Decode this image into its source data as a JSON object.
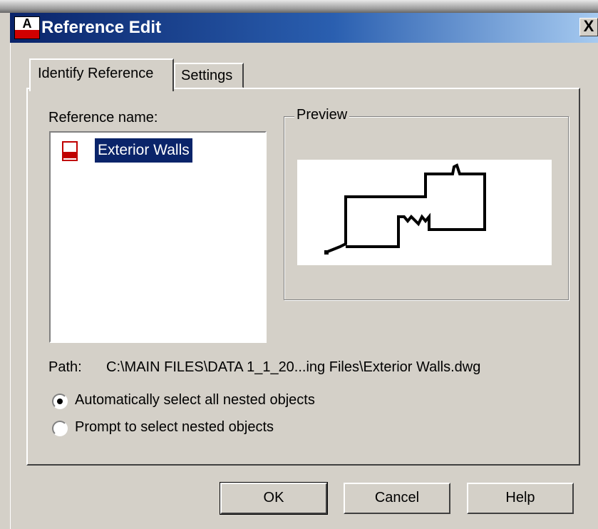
{
  "window": {
    "title": "Reference Edit",
    "close_label": "X",
    "app_icon_letter": "A"
  },
  "tabs": [
    {
      "label": "Identify Reference",
      "active": true
    },
    {
      "label": "Settings",
      "active": false
    }
  ],
  "reference": {
    "label": "Reference name:",
    "items": [
      {
        "name": "Exterior Walls",
        "icon": "dwg-file-icon",
        "selected": true
      }
    ]
  },
  "preview": {
    "label": "Preview"
  },
  "path": {
    "label": "Path:",
    "value": "C:\\MAIN FILES\\DATA 1_1_20...ing Files\\Exterior Walls.dwg"
  },
  "options": [
    {
      "label": "Automatically select all nested objects",
      "checked": true
    },
    {
      "label": "Prompt to select nested objects",
      "checked": false
    }
  ],
  "buttons": {
    "ok": "OK",
    "cancel": "Cancel",
    "help": "Help"
  },
  "colors": {
    "titlebar_start": "#0a246a",
    "titlebar_end": "#a6caf0",
    "selection": "#0a246a",
    "face": "#d4d0c8"
  }
}
